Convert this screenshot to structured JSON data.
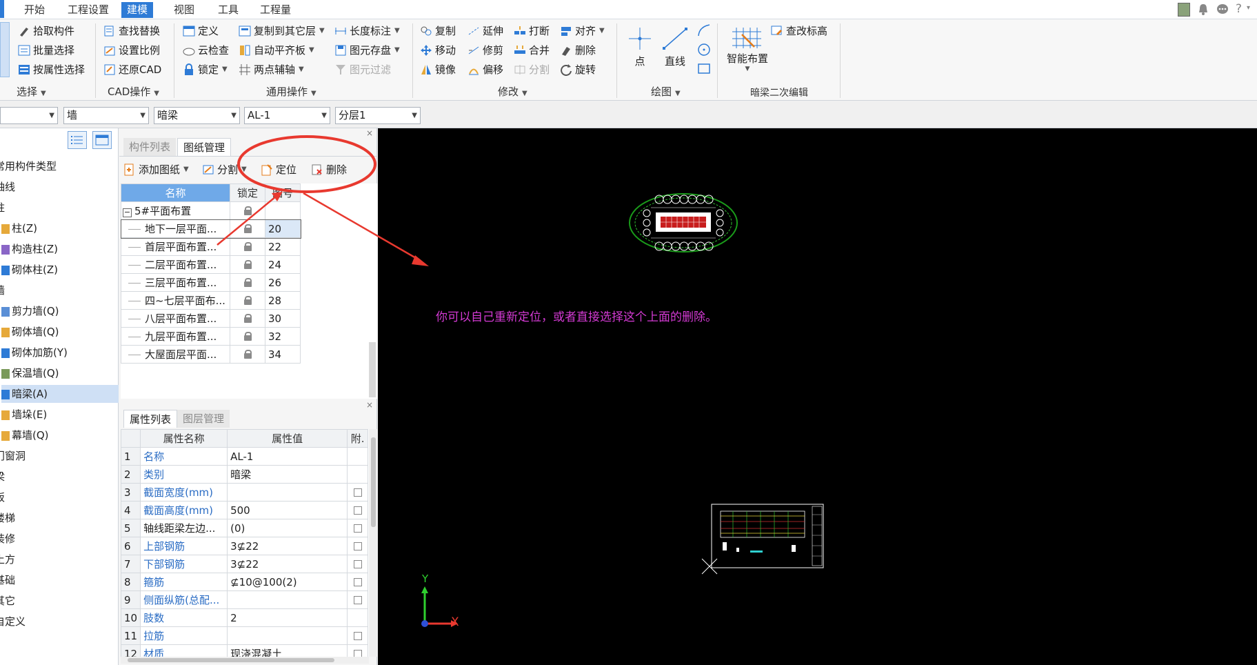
{
  "menu": {
    "items": [
      "开始",
      "工程设置",
      "建模",
      "视图",
      "工具",
      "工程量"
    ],
    "active": "建模"
  },
  "ribbon": {
    "select_group": {
      "label": "选择",
      "items": [
        "拾取构件",
        "批量选择",
        "按属性选择"
      ]
    },
    "cad_group": {
      "label": "CAD操作",
      "items": [
        "查找替换",
        "设置比例",
        "还原CAD"
      ]
    },
    "common_group": {
      "label": "通用操作",
      "col1": [
        "定义",
        "云检查",
        "锁定"
      ],
      "col2": [
        "复制到其它层",
        "自动平齐板",
        "两点辅轴"
      ],
      "col3": [
        "长度标注",
        "图元存盘",
        "图元过滤"
      ]
    },
    "modify_group": {
      "label": "修改",
      "col1": [
        "复制",
        "移动",
        "镜像"
      ],
      "col2": [
        "延伸",
        "修剪",
        "偏移"
      ],
      "col3": [
        "打断",
        "合并",
        "分割"
      ],
      "col4": [
        "对齐",
        "删除",
        "旋转"
      ]
    },
    "draw_group": {
      "label": "绘图",
      "point": "点",
      "line": "直线"
    },
    "beam_group": {
      "label": "暗梁二次编辑",
      "smart": "智能布置",
      "check_elev": "查改标高"
    }
  },
  "combos": [
    "墙",
    "暗梁",
    "AL-1",
    "分层1"
  ],
  "left_tree": [
    {
      "label": "常用构件类型"
    },
    {
      "label": "轴线"
    },
    {
      "label": "柱"
    },
    {
      "label": "柱(Z)"
    },
    {
      "label": "构造柱(Z)"
    },
    {
      "label": "砌体柱(Z)"
    },
    {
      "label": "墙"
    },
    {
      "label": "剪力墙(Q)"
    },
    {
      "label": "砌体墙(Q)"
    },
    {
      "label": "砌体加筋(Y)"
    },
    {
      "label": "保温墙(Q)"
    },
    {
      "label": "暗梁(A)"
    },
    {
      "label": "墙垛(E)"
    },
    {
      "label": "幕墙(Q)"
    },
    {
      "label": "门窗洞"
    },
    {
      "label": "梁"
    },
    {
      "label": "板"
    },
    {
      "label": "楼梯"
    },
    {
      "label": "装修"
    },
    {
      "label": "土方"
    },
    {
      "label": "基础"
    },
    {
      "label": "其它"
    },
    {
      "label": "自定义"
    }
  ],
  "drawing_panel": {
    "tabs": [
      "构件列表",
      "图纸管理"
    ],
    "tools": {
      "add": "添加图纸",
      "split": "分割",
      "locate": "定位",
      "delete": "删除"
    },
    "headers": {
      "name": "名称",
      "lock": "锁定",
      "no": "图号"
    },
    "root": "5#平面布置",
    "rows": [
      {
        "name": "地下一层平面...",
        "no": "20"
      },
      {
        "name": "首层平面布置...",
        "no": "22"
      },
      {
        "name": "二层平面布置...",
        "no": "24"
      },
      {
        "name": "三层平面布置...",
        "no": "26"
      },
      {
        "name": "四~七层平面布...",
        "no": "28"
      },
      {
        "name": "八层平面布置...",
        "no": "30"
      },
      {
        "name": "九层平面布置...",
        "no": "32"
      },
      {
        "name": "大屋面层平面...",
        "no": "34"
      }
    ]
  },
  "property_panel": {
    "tabs": [
      "属性列表",
      "图层管理"
    ],
    "headers": {
      "name": "属性名称",
      "value": "属性值",
      "extra": "附."
    },
    "rows": [
      {
        "idx": "1",
        "name": "名称",
        "value": "AL-1"
      },
      {
        "idx": "2",
        "name": "类别",
        "value": "暗梁"
      },
      {
        "idx": "3",
        "name": "截面宽度(mm)",
        "value": ""
      },
      {
        "idx": "4",
        "name": "截面高度(mm)",
        "value": "500"
      },
      {
        "idx": "5",
        "name": "轴线距梁左边...",
        "value": "(0)"
      },
      {
        "idx": "6",
        "name": "上部钢筋",
        "value": "3⊈22"
      },
      {
        "idx": "7",
        "name": "下部钢筋",
        "value": "3⊈22"
      },
      {
        "idx": "8",
        "name": "箍筋",
        "value": "⊈10@100(2)"
      },
      {
        "idx": "9",
        "name": "侧面纵筋(总配...",
        "value": ""
      },
      {
        "idx": "10",
        "name": "肢数",
        "value": "2"
      },
      {
        "idx": "11",
        "name": "拉筋",
        "value": ""
      },
      {
        "idx": "12",
        "name": "材质",
        "value": "现浇混凝土"
      }
    ]
  },
  "canvas": {
    "note": "你可以自己重新定位，或者直接选择这个上面的删除。",
    "note_color": "#d43ad4",
    "axis_x": "X",
    "axis_y": "Y"
  },
  "colors": {
    "accent": "#2e7bd6",
    "annotation": "#e8392f"
  }
}
